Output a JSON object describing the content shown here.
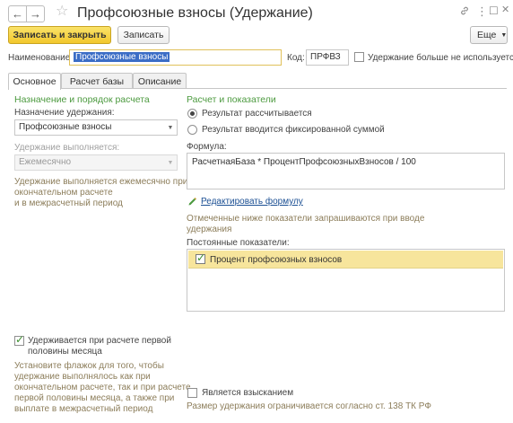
{
  "window": {
    "title": "Профсоюзные взносы (Удержание)",
    "nav_back": "←",
    "nav_forward": "→",
    "star": "☆",
    "link_icon": "🔗",
    "more_icon": "⋮",
    "maximize_icon": "☐",
    "close_icon": "✕"
  },
  "toolbar": {
    "save_close": "Записать и закрыть",
    "save": "Записать",
    "more": "Еще",
    "help": "?"
  },
  "header": {
    "name_label": "Наименование:",
    "name_value": "Профсоюзные взносы",
    "code_label": "Код:",
    "code_value": "ПРФВЗ",
    "unused_label": "Удержание больше не используется"
  },
  "tabs": [
    {
      "label": "Основное"
    },
    {
      "label": "Расчет базы"
    },
    {
      "label": "Описание"
    }
  ],
  "left": {
    "section_title": "Назначение и порядок расчета",
    "purpose_label": "Назначение удержания:",
    "purpose_value": "Профсоюзные взносы",
    "performed_label": "Удержание выполняется:",
    "performed_value": "Ежемесячно",
    "performed_hint_1": "Удержание выполняется ежемесячно при",
    "performed_hint_2": "окончательном расчете",
    "performed_hint_3": "и в межрасчетный период",
    "first_half_label_1": "Удерживается при расчете первой",
    "first_half_label_2": "половины месяца",
    "first_half_hint_1": "Установите флажок для того, чтобы",
    "first_half_hint_2": "удержание выполнялось как при",
    "first_half_hint_3": "окончательном расчете, так и при расчете",
    "first_half_hint_4": "первой половины месяца, а также при",
    "first_half_hint_5": "выплате в межрасчетный период"
  },
  "right": {
    "section_title": "Расчет и показатели",
    "radio_calculated": "Результат рассчитывается",
    "radio_fixed": "Результат вводится фиксированной суммой",
    "formula_label": "Формула:",
    "formula_value": "РасчетнаяБаза * ПроцентПрофсоюзныхВзносов / 100",
    "edit_formula": "Редактировать формулу",
    "indicators_hint_1": "Отмеченные ниже показатели запрашиваются при вводе",
    "indicators_hint_2": "удержания",
    "permanent_label": "Постоянные показатели:",
    "indicator_1": "Процент профсоюзных взносов",
    "recovery_label": "Является взысканием",
    "limit_hint": "Размер удержания ограничивается согласно ст. 138 ТК РФ"
  }
}
